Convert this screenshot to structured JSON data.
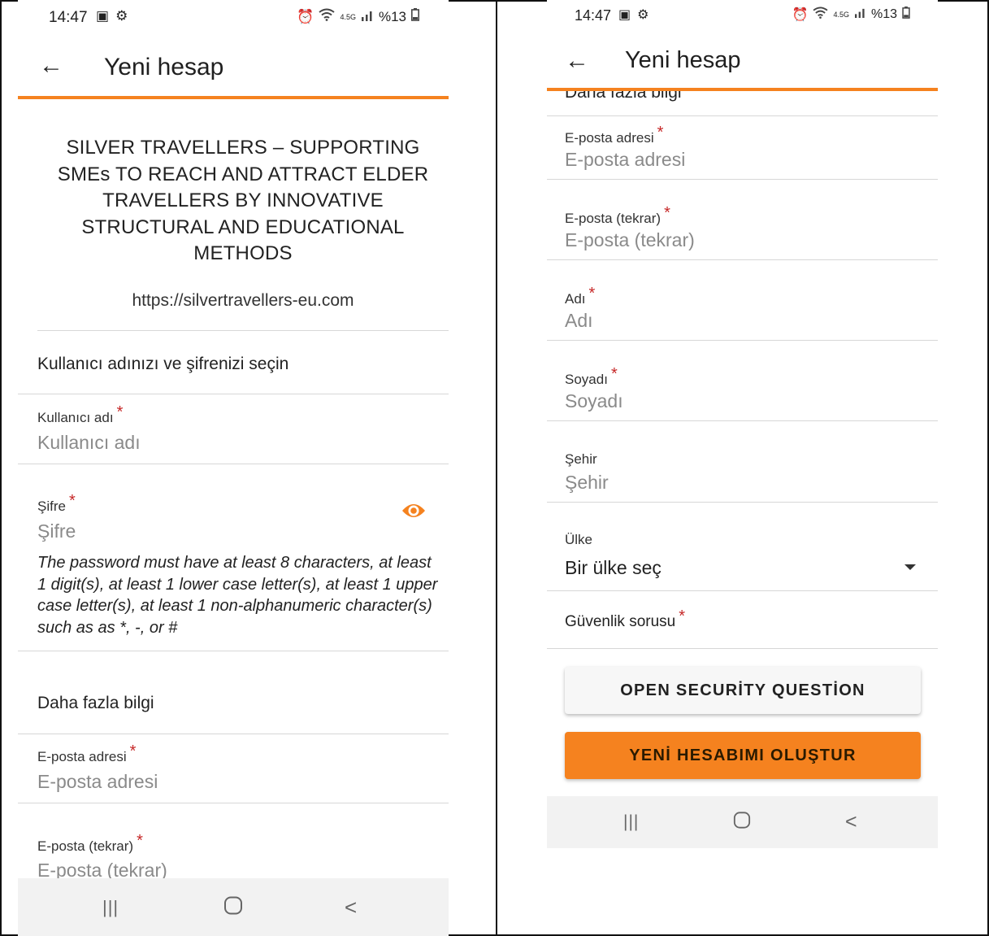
{
  "status_bar": {
    "time": "14:47",
    "left_icons": [
      "image-icon",
      "gear-icon"
    ],
    "right_icons": [
      "alarm-icon",
      "wifi-icon",
      "network-icon",
      "signal-icon",
      "battery-icon"
    ],
    "network_badge": "4.5G",
    "battery_text": "%13"
  },
  "app_bar": {
    "title": "Yeni hesap",
    "back_icon": "back-arrow-icon"
  },
  "project": {
    "title": "SILVER TRAVELLERS – SUPPORTING SMEs TO REACH AND ATTRACT ELDER TRAVELLERS BY INNOVATIVE STRUCTURAL AND EDUCATIONAL METHODS",
    "url": "https://silvertravellers-eu.com"
  },
  "sections": {
    "credentials": "Kullanıcı adınızı ve şifrenizi seçin",
    "more_info": "Daha fazla bilgi",
    "more_info_partial": "Daha fazla bilgi"
  },
  "fields": {
    "username": {
      "label": "Kullanıcı adı",
      "placeholder": "Kullanıcı adı",
      "required": "*"
    },
    "password": {
      "label": "Şifre",
      "placeholder": "Şifre",
      "required": "*",
      "toggle_icon": "eye-icon"
    },
    "email": {
      "label": "E-posta adresi",
      "placeholder": "E-posta adresi",
      "required": "*"
    },
    "email_repeat": {
      "label": "E-posta (tekrar)",
      "placeholder": "E-posta (tekrar)",
      "required": "*"
    },
    "first_name": {
      "label": "Adı",
      "placeholder": "Adı",
      "required": "*"
    },
    "last_name": {
      "label": "Soyadı",
      "placeholder": "Soyadı",
      "required": "*"
    },
    "city": {
      "label": "Şehir",
      "placeholder": "Şehir"
    },
    "country": {
      "label": "Ülke",
      "value": "Bir ülke seç"
    },
    "security": {
      "label": "Güvenlik sorusu",
      "required": "*"
    }
  },
  "password_hint": "The password must have at least 8 characters, at least 1 digit(s), at least 1 lower case letter(s), at least 1 upper case letter(s), at least 1 non-alphanumeric character(s) such as as *, -, or #",
  "buttons": {
    "open_security": "OPEN SECURİTY QUESTİON",
    "create_account": "YENİ HESABIMI OLUŞTUR"
  },
  "nav_bar": {
    "recents": "|||",
    "home": "○",
    "back": "<"
  },
  "colors": {
    "accent": "#f5821f",
    "required": "#c62828",
    "navbar_bg": "#f2f2f2"
  }
}
